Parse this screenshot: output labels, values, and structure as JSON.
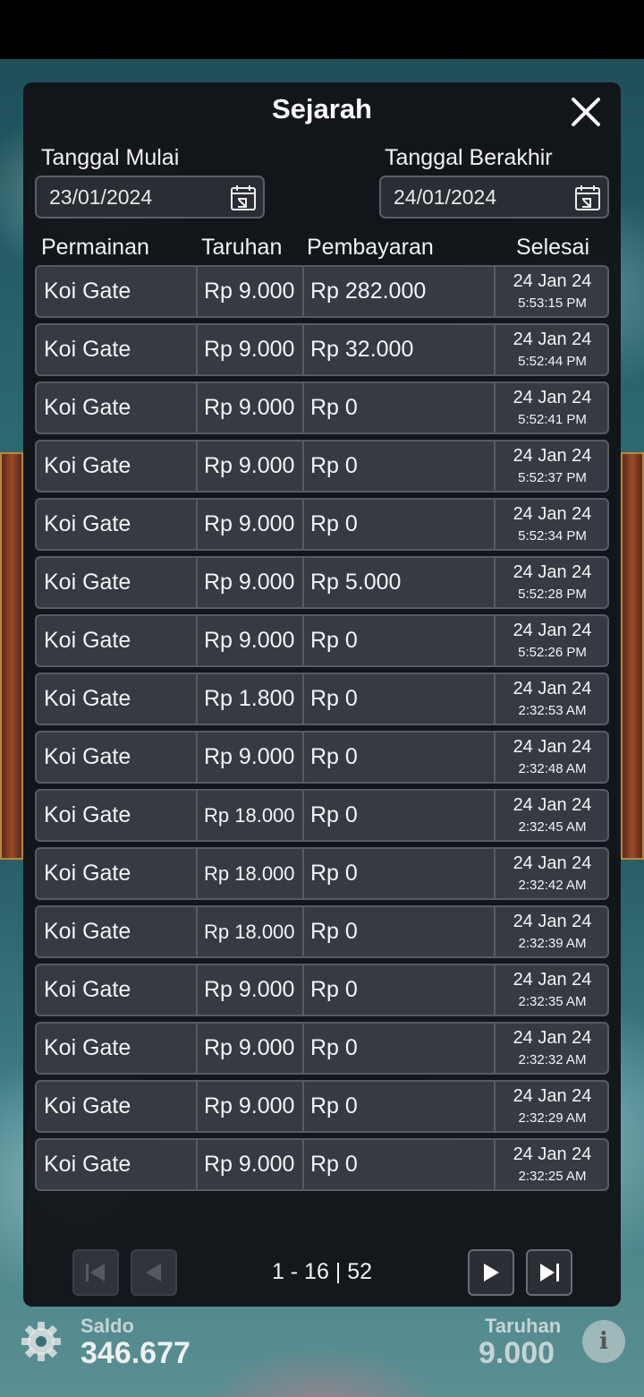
{
  "dialog": {
    "title": "Sejarah",
    "start_label": "Tanggal Mulai",
    "start_value": "23/01/2024",
    "end_label": "Tanggal Berakhir",
    "end_value": "24/01/2024"
  },
  "table": {
    "headers": [
      "Permainan",
      "Taruhan",
      "Pembayaran",
      "Selesai"
    ],
    "rows": [
      {
        "game": "Koi Gate",
        "bet": "Rp 9.000",
        "payout": "Rp 282.000",
        "date": "24 Jan 24",
        "time": "5:53:15 PM"
      },
      {
        "game": "Koi Gate",
        "bet": "Rp 9.000",
        "payout": "Rp 32.000",
        "date": "24 Jan 24",
        "time": "5:52:44 PM"
      },
      {
        "game": "Koi Gate",
        "bet": "Rp 9.000",
        "payout": "Rp 0",
        "date": "24 Jan 24",
        "time": "5:52:41 PM"
      },
      {
        "game": "Koi Gate",
        "bet": "Rp 9.000",
        "payout": "Rp 0",
        "date": "24 Jan 24",
        "time": "5:52:37 PM"
      },
      {
        "game": "Koi Gate",
        "bet": "Rp 9.000",
        "payout": "Rp 0",
        "date": "24 Jan 24",
        "time": "5:52:34 PM"
      },
      {
        "game": "Koi Gate",
        "bet": "Rp 9.000",
        "payout": "Rp 5.000",
        "date": "24 Jan 24",
        "time": "5:52:28 PM"
      },
      {
        "game": "Koi Gate",
        "bet": "Rp 9.000",
        "payout": "Rp 0",
        "date": "24 Jan 24",
        "time": "5:52:26 PM"
      },
      {
        "game": "Koi Gate",
        "bet": "Rp 1.800",
        "payout": "Rp 0",
        "date": "24 Jan 24",
        "time": "2:32:53 AM"
      },
      {
        "game": "Koi Gate",
        "bet": "Rp 9.000",
        "payout": "Rp 0",
        "date": "24 Jan 24",
        "time": "2:32:48 AM"
      },
      {
        "game": "Koi Gate",
        "bet": "Rp 18.000",
        "payout": "Rp 0",
        "date": "24 Jan 24",
        "time": "2:32:45 AM"
      },
      {
        "game": "Koi Gate",
        "bet": "Rp 18.000",
        "payout": "Rp 0",
        "date": "24 Jan 24",
        "time": "2:32:42 AM"
      },
      {
        "game": "Koi Gate",
        "bet": "Rp 18.000",
        "payout": "Rp 0",
        "date": "24 Jan 24",
        "time": "2:32:39 AM"
      },
      {
        "game": "Koi Gate",
        "bet": "Rp 9.000",
        "payout": "Rp 0",
        "date": "24 Jan 24",
        "time": "2:32:35 AM"
      },
      {
        "game": "Koi Gate",
        "bet": "Rp 9.000",
        "payout": "Rp 0",
        "date": "24 Jan 24",
        "time": "2:32:32 AM"
      },
      {
        "game": "Koi Gate",
        "bet": "Rp 9.000",
        "payout": "Rp 0",
        "date": "24 Jan 24",
        "time": "2:32:29 AM"
      },
      {
        "game": "Koi Gate",
        "bet": "Rp 9.000",
        "payout": "Rp 0",
        "date": "24 Jan 24",
        "time": "2:32:25 AM"
      }
    ]
  },
  "pagination": {
    "text": "1 - 16 | 52",
    "first_enabled": false,
    "prev_enabled": false,
    "next_enabled": true,
    "last_enabled": true
  },
  "hud": {
    "balance_label": "Saldo",
    "balance_value": "346.677",
    "bet_label": "Taruhan",
    "bet_value": "9.000"
  },
  "colors": {
    "panel": "#121317",
    "row_bg": "#363a43",
    "row_border": "#575b63"
  }
}
